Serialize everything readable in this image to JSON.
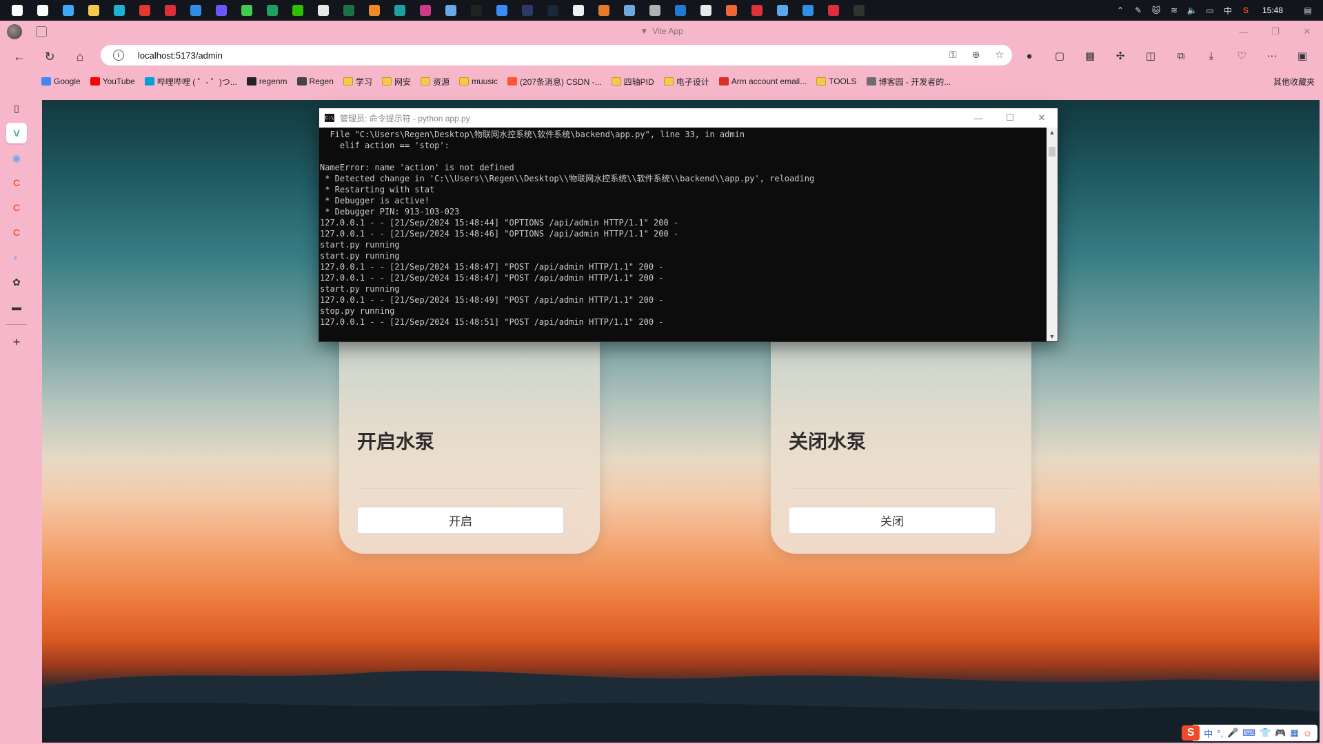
{
  "taskbar": {
    "apps": [
      {
        "name": "start-icon",
        "color": "#ffffff"
      },
      {
        "name": "search-icon",
        "color": "#ffffff"
      },
      {
        "name": "desktop-icon",
        "color": "#3fa9f5"
      },
      {
        "name": "file-explorer-icon",
        "color": "#f6c94c"
      },
      {
        "name": "edge-icon",
        "color": "#1fb1d3"
      },
      {
        "name": "wps-icon",
        "color": "#e2382f"
      },
      {
        "name": "xmind-icon",
        "color": "#e02d3c"
      },
      {
        "name": "vscode-icon",
        "color": "#2f8ee6"
      },
      {
        "name": "intellij-icon",
        "color": "#6b57ff"
      },
      {
        "name": "qt-icon",
        "color": "#41cd52"
      },
      {
        "name": "app-green-icon",
        "color": "#20a060"
      },
      {
        "name": "wechat-icon",
        "color": "#2dc100"
      },
      {
        "name": "notepad-icon",
        "color": "#e8e8e8"
      },
      {
        "name": "excel-icon",
        "color": "#1e7145"
      },
      {
        "name": "app-orange-icon",
        "color": "#f08a24"
      },
      {
        "name": "app-teal-icon",
        "color": "#20a0a0"
      },
      {
        "name": "app-pink-icon",
        "color": "#d0388a"
      },
      {
        "name": "app-bug-icon",
        "color": "#6aa8e8"
      },
      {
        "name": "qq-icon",
        "color": "#222222"
      },
      {
        "name": "app-blue-icon",
        "color": "#3b8df5"
      },
      {
        "name": "app-dark-icon",
        "color": "#2b3a67"
      },
      {
        "name": "steam-icon",
        "color": "#1b2838"
      },
      {
        "name": "typora-icon",
        "color": "#f0f0f0"
      },
      {
        "name": "fox-icon",
        "color": "#e57c2d"
      },
      {
        "name": "app-monitor-icon",
        "color": "#6fa8dc"
      },
      {
        "name": "app-leaf-icon",
        "color": "#b0b0b0"
      },
      {
        "name": "mx-icon",
        "color": "#1f7ad4"
      },
      {
        "name": "app-circle-icon",
        "color": "#e8e8e8"
      },
      {
        "name": "app-tool-icon",
        "color": "#f0663a"
      },
      {
        "name": "netease-music-icon",
        "color": "#e0323a"
      },
      {
        "name": "app-window-icon",
        "color": "#5aa6e8"
      },
      {
        "name": "vscode-2-icon",
        "color": "#2f8ee6"
      },
      {
        "name": "xmind-2-icon",
        "color": "#e02d3c"
      },
      {
        "name": "cmd-icon",
        "color": "#333333"
      }
    ],
    "clock": "15:48",
    "ime_lang": "中"
  },
  "browser": {
    "window_title": "Vite App",
    "url": "localhost:5173/admin",
    "bookmarks": [
      {
        "label": "Google",
        "icon": "google-icon",
        "color": "#4285f4"
      },
      {
        "label": "YouTube",
        "icon": "youtube-icon",
        "color": "#ff0000"
      },
      {
        "label": "哔哩哔哩 ( ゜- ゜)つ...",
        "icon": "bilibili-icon",
        "color": "#00a1d6"
      },
      {
        "label": "regenm",
        "icon": "github-icon",
        "color": "#222222"
      },
      {
        "label": "Regen",
        "icon": "regen-icon",
        "color": "#444444"
      },
      {
        "label": "学习",
        "icon": "folder-icon",
        "color": "#f6c94c"
      },
      {
        "label": "网安",
        "icon": "folder-icon",
        "color": "#f6c94c"
      },
      {
        "label": "资源",
        "icon": "folder-icon",
        "color": "#f6c94c"
      },
      {
        "label": "muusic",
        "icon": "folder-icon",
        "color": "#f6c94c"
      },
      {
        "label": "(207条消息) CSDN -...",
        "icon": "csdn-icon",
        "color": "#fc5531"
      },
      {
        "label": "四轴PID",
        "icon": "folder-icon",
        "color": "#f6c94c"
      },
      {
        "label": "电子设计",
        "icon": "folder-icon",
        "color": "#f6c94c"
      },
      {
        "label": "Arm account email...",
        "icon": "gmail-icon",
        "color": "#d93025"
      },
      {
        "label": "TOOLS",
        "icon": "folder-icon",
        "color": "#f6c94c"
      },
      {
        "label": "博客园 - 开发者的...",
        "icon": "cnblogs-icon",
        "color": "#6e6e6e"
      }
    ],
    "other_bookmarks": "其他收藏夹"
  },
  "page": {
    "cards": [
      {
        "title": "开启水泵",
        "button": "开启"
      },
      {
        "title": "关闭水泵",
        "button": "关闭"
      }
    ]
  },
  "cmd": {
    "title": "管理员: 命令提示符 - python  app.py",
    "lines": [
      "  File \"C:\\Users\\Regen\\Desktop\\物联网水控系统\\软件系统\\backend\\app.py\", line 33, in admin",
      "    elif action == 'stop':",
      "",
      "NameError: name 'action' is not defined",
      " * Detected change in 'C:\\\\Users\\\\Regen\\\\Desktop\\\\物联网水控系统\\\\软件系统\\\\backend\\\\app.py', reloading",
      " * Restarting with stat",
      " * Debugger is active!",
      " * Debugger PIN: 913-103-023",
      "127.0.0.1 - - [21/Sep/2024 15:48:44] \"OPTIONS /api/admin HTTP/1.1\" 200 -",
      "127.0.0.1 - - [21/Sep/2024 15:48:46] \"OPTIONS /api/admin HTTP/1.1\" 200 -",
      "start.py running",
      "start.py running",
      "127.0.0.1 - - [21/Sep/2024 15:48:47] \"POST /api/admin HTTP/1.1\" 200 -",
      "127.0.0.1 - - [21/Sep/2024 15:48:47] \"POST /api/admin HTTP/1.1\" 200 -",
      "start.py running",
      "127.0.0.1 - - [21/Sep/2024 15:48:49] \"POST /api/admin HTTP/1.1\" 200 -",
      "stop.py running",
      "127.0.0.1 - - [21/Sep/2024 15:48:51] \"POST /api/admin HTTP/1.1\" 200 -"
    ]
  },
  "ime": {
    "logo": "S",
    "lang": "中"
  },
  "colors": {
    "chrome_bg": "#f7b7cb",
    "taskbar_bg": "#12151c",
    "cmd_bg": "#0c0c0c",
    "cmd_text": "#cccccc"
  }
}
